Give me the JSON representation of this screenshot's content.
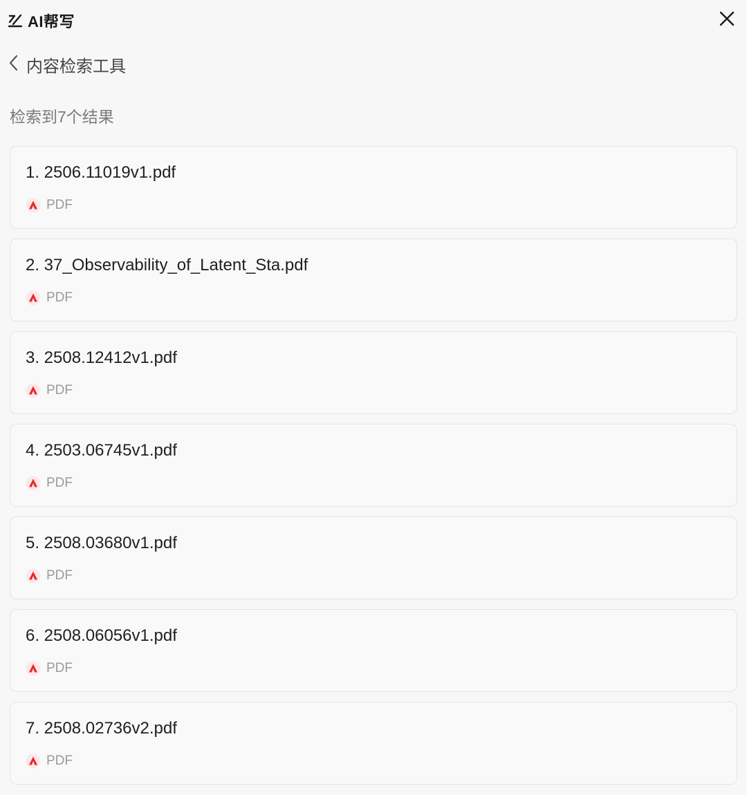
{
  "header": {
    "title": "AI帮写"
  },
  "nav": {
    "back_label": "内容检索工具"
  },
  "results": {
    "count_text": "检索到7个结果",
    "items": [
      {
        "title": "1. 2506.11019v1.pdf",
        "type": "PDF",
        "icon": "pdf-icon"
      },
      {
        "title": "2. 37_Observability_of_Latent_Sta.pdf",
        "type": "PDF",
        "icon": "pdf-icon"
      },
      {
        "title": "3. 2508.12412v1.pdf",
        "type": "PDF",
        "icon": "pdf-icon"
      },
      {
        "title": "4. 2503.06745v1.pdf",
        "type": "PDF",
        "icon": "pdf-icon"
      },
      {
        "title": "5. 2508.03680v1.pdf",
        "type": "PDF",
        "icon": "pdf-icon"
      },
      {
        "title": "6. 2508.06056v1.pdf",
        "type": "PDF",
        "icon": "pdf-icon"
      },
      {
        "title": "7. 2508.02736v2.pdf",
        "type": "PDF",
        "icon": "pdf-icon"
      }
    ]
  },
  "colors": {
    "background": "#f7f7f7",
    "card_border": "#e4e4e4",
    "pdf_accent": "#e8262c",
    "muted_text": "#9a9a9a"
  }
}
